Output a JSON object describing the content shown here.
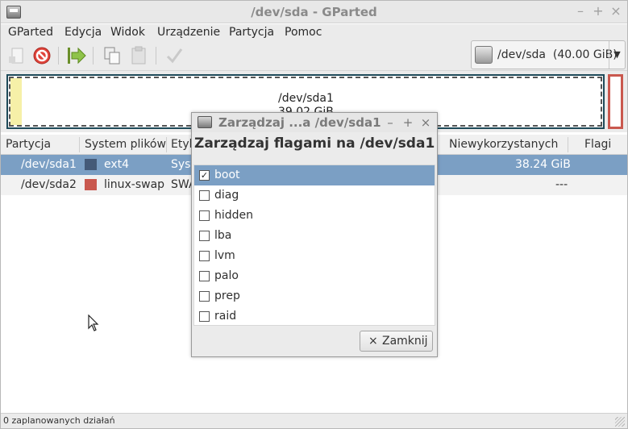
{
  "window": {
    "title": "/dev/sda - GParted",
    "controls": {
      "minimize": "–",
      "maximize": "+",
      "close": "×"
    }
  },
  "menubar": [
    "GParted",
    "Edycja",
    "Widok",
    "Urządzenie",
    "Partycja",
    "Pomoc"
  ],
  "toolbar": {
    "icons": [
      "new-icon",
      "delete-icon",
      "apply-icon",
      "copy-icon",
      "paste-icon",
      "check-icon"
    ],
    "device": "/dev/sda  (40.00 GiB)",
    "device_arrow": "▼"
  },
  "diskmap": {
    "partition_name": "/dev/sda1",
    "partition_size": "39.02 GiB",
    "colors": {
      "ext4_border": "#1e4a59",
      "swap_border": "#c9584e",
      "used_fill": "#f6f0a8"
    }
  },
  "table": {
    "headers": [
      "Partycja",
      "System plików",
      "Etykieta",
      "Niewykorzystanych",
      "Flagi"
    ],
    "rows": [
      {
        "partition": "/dev/sda1",
        "fs": "ext4",
        "fs_color": "#445a78",
        "label": "System",
        "unused": "38.24 GiB",
        "flags": ""
      },
      {
        "partition": "/dev/sda2",
        "fs": "linux-swap",
        "fs_color": "#c9584e",
        "label": "SWAP",
        "unused": "---",
        "flags": ""
      }
    ]
  },
  "statusbar": {
    "text": "0 zaplanowanych działań"
  },
  "dialog": {
    "title": "Zarządzaj ...a /dev/sda1",
    "controls": {
      "minimize": "–",
      "maximize": "+",
      "close": "×"
    },
    "heading": "Zarządzaj flagami na /dev/sda1",
    "flags": [
      {
        "name": "boot",
        "checked": true
      },
      {
        "name": "diag",
        "checked": false
      },
      {
        "name": "hidden",
        "checked": false
      },
      {
        "name": "lba",
        "checked": false
      },
      {
        "name": "lvm",
        "checked": false
      },
      {
        "name": "palo",
        "checked": false
      },
      {
        "name": "prep",
        "checked": false
      },
      {
        "name": "raid",
        "checked": false
      }
    ],
    "close_button": {
      "icon": "×",
      "label": "Zamknij"
    }
  }
}
